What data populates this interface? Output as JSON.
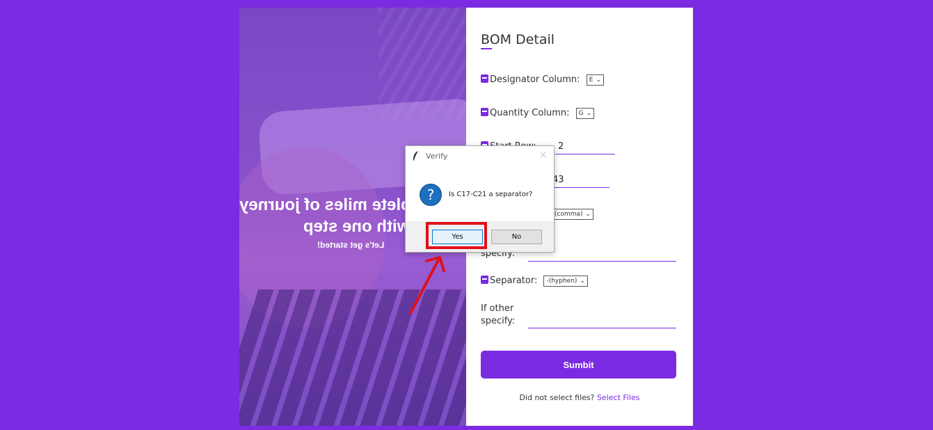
{
  "hero": {
    "headline_line1": "Complete miles of journey",
    "headline_line2": "with one step",
    "subtext": "Let's get started!"
  },
  "form": {
    "title": "BOM Detail",
    "designator": {
      "label": "Designator Column:",
      "value": "E"
    },
    "quantity": {
      "label": "Quantity Column:",
      "value": "G"
    },
    "start_row": {
      "label": "Start Row:",
      "value": "2"
    },
    "end_row": {
      "value": "43"
    },
    "delimiter": {
      "value": "(comma)"
    },
    "delimiter_other": {
      "label": "specify:"
    },
    "separator": {
      "label": "Separator:",
      "value": "-(hyphen)"
    },
    "separator_other": {
      "label_line1": "If other",
      "label_line2": "specify:"
    },
    "submit_label": "Sumbit",
    "footer_text": "Did not select files?",
    "footer_link": "Select Files"
  },
  "dialog": {
    "title": "Verify",
    "message": "Is C17-C21 a separator?",
    "yes_label": "Yes",
    "no_label": "No",
    "icon": "question-icon",
    "close_icon": "close-icon"
  },
  "colors": {
    "background": "#7b2be2",
    "accent": "#7b2be2",
    "annotation": "#e0101a"
  }
}
